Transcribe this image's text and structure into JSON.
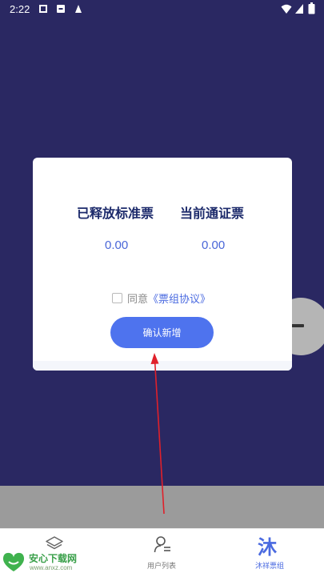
{
  "status_bar": {
    "time": "2:22"
  },
  "dialog": {
    "columns": [
      {
        "title": "已释放标准票",
        "value": "0.00"
      },
      {
        "title": "当前通证票",
        "value": "0.00"
      }
    ],
    "agreement": {
      "prefix": "同意",
      "link": "《票组协议》"
    },
    "confirm_label": "确认新增"
  },
  "bottom_nav": {
    "items": [
      {
        "label": "",
        "icon": "layers-icon"
      },
      {
        "label": "用户列表",
        "icon": "user-list-icon"
      },
      {
        "label": "沐祥票组",
        "icon": "mu-glyph-icon",
        "glyph": "沐",
        "active": true
      }
    ]
  },
  "watermark": {
    "title": "安心下载网",
    "url": "www.anxz.com"
  },
  "colors": {
    "background": "#2a2862",
    "accent": "#4e73ee",
    "title": "#1c2a6b",
    "value": "#4966d8",
    "annotation": "#e0202a"
  }
}
